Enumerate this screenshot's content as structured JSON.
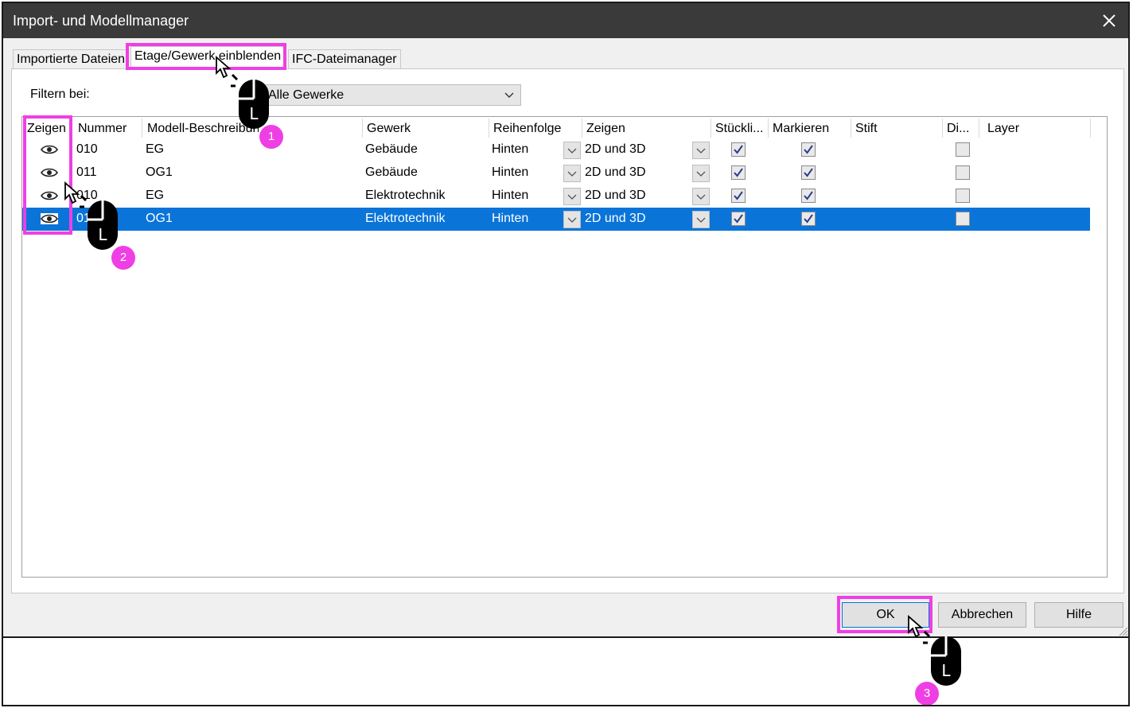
{
  "window": {
    "title": "Import- und Modellmanager",
    "close_icon": "close-icon"
  },
  "tabs": [
    {
      "label": "Importierte Dateien",
      "active": false
    },
    {
      "label": "Etage/Gewerk einblenden",
      "active": true
    },
    {
      "label": "IFC-Dateimanager",
      "active": false
    }
  ],
  "filter": {
    "label": "Filtern bei:",
    "value": "Alle Gewerke"
  },
  "table": {
    "columns": [
      "Zeigen",
      "Nummer",
      "Modell-Beschreibung",
      "Gewerk",
      "Reihenfolge",
      "Zeigen",
      "Stückli...",
      "Markieren",
      "Stift",
      "Di...",
      "Layer"
    ],
    "rows": [
      {
        "nummer": "010",
        "beschreibung": "EG",
        "gewerk": "Gebäude",
        "reihenfolge": "Hinten",
        "zeigen": "2D und 3D",
        "stueckliste": true,
        "markieren": true,
        "di": false,
        "selected": false
      },
      {
        "nummer": "011",
        "beschreibung": "OG1",
        "gewerk": "Gebäude",
        "reihenfolge": "Hinten",
        "zeigen": "2D und 3D",
        "stueckliste": true,
        "markieren": true,
        "di": false,
        "selected": false
      },
      {
        "nummer": "010",
        "beschreibung": "EG",
        "gewerk": "Elektrotechnik",
        "reihenfolge": "Hinten",
        "zeigen": "2D und 3D",
        "stueckliste": true,
        "markieren": true,
        "di": false,
        "selected": false
      },
      {
        "nummer": "011",
        "beschreibung": "OG1",
        "gewerk": "Elektrotechnik",
        "reihenfolge": "Hinten",
        "zeigen": "2D und 3D",
        "stueckliste": true,
        "markieren": true,
        "di": false,
        "selected": true
      }
    ]
  },
  "buttons": {
    "ok": "OK",
    "cancel": "Abbrechen",
    "help": "Hilfe"
  },
  "annotations": {
    "step1": "1",
    "step2": "2",
    "step3": "3",
    "mouse_button": "L",
    "highlight_color": "#ef3fe4"
  },
  "colors": {
    "titlebar": "#3a3a3a",
    "selection": "#0a74d9"
  }
}
